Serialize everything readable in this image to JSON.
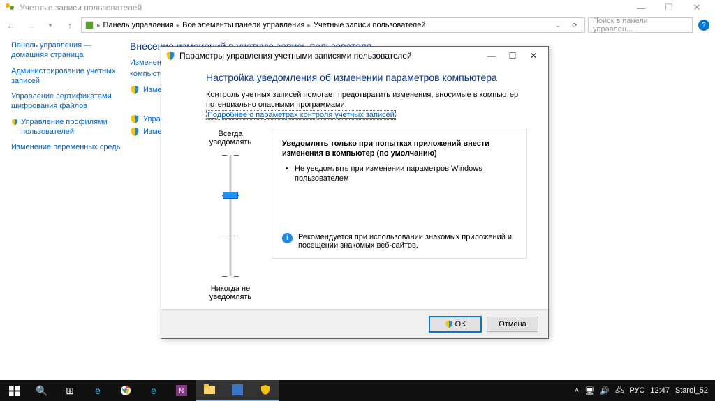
{
  "titlebar": {
    "title": "Учетные записи пользователей"
  },
  "breadcrumbs": {
    "b1": "Панель управления",
    "b2": "Все элементы панели управления",
    "b3": "Учетные записи пользователей"
  },
  "search": {
    "placeholder": "Поиск в панели управлен..."
  },
  "sidebar": {
    "l1": "Панель управления — домашняя страница",
    "l2": "Администрирование учетных записей",
    "l3": "Управление сертификатами шифрования файлов",
    "l4": "Управление профилями пользователей",
    "l5": "Изменение переменных среды"
  },
  "main": {
    "heading": "Внесение изменений в учетную запись пользователя",
    "o1a": "Изменение",
    "o1b": "",
    "o1c": "компьютер",
    "o2": "Изменение",
    "o3": "Управление",
    "o4": "Изменить п"
  },
  "dialog": {
    "title": "Параметры управления учетными записями пользователей",
    "heading": "Настройка уведомления об изменении параметров компьютера",
    "desc": "Контроль учетных записей помогает предотвратить изменения, вносимые в компьютер потенциально опасными программами.",
    "link": "Подробнее о параметрах контроля учетных записей",
    "slider_top": "Всегда уведомлять",
    "slider_bottom": "Никогда не уведомлять",
    "info_title": "Уведомлять только при попытках приложений внести изменения в компьютер (по умолчанию)",
    "info_bullet": "Не уведомлять при изменении параметров Windows пользователем",
    "recommend": "Рекомендуется при использовании знакомых приложений и посещении знакомых веб-сайтов.",
    "ok": "OK",
    "cancel": "Отмена"
  },
  "taskbar": {
    "lang": "РУС",
    "time": "12:47",
    "user": "Starol_52"
  }
}
